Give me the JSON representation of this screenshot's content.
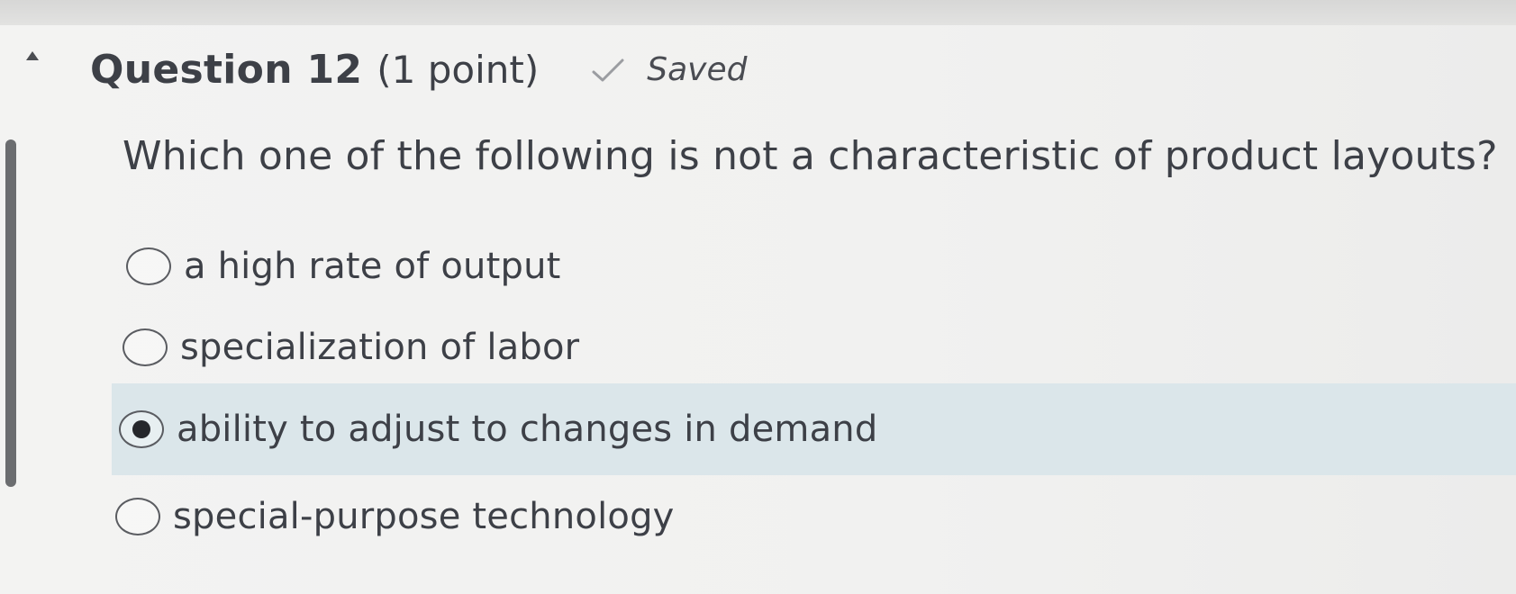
{
  "question": {
    "title": "Question 12",
    "points": "(1 point)",
    "status_label": "Saved",
    "prompt": "Which one of the following is not a characteristic of product layouts?"
  },
  "options": [
    {
      "label": "a high rate of output",
      "selected": false
    },
    {
      "label": "specialization of labor",
      "selected": false
    },
    {
      "label": "ability to adjust to changes in demand",
      "selected": true
    },
    {
      "label": "special-purpose technology",
      "selected": false
    }
  ],
  "colors": {
    "selected_row": "#dbe6ea",
    "text": "#3d4047",
    "rail": "#6b6d70"
  },
  "icons": {
    "collapse": "collapse-up-icon",
    "saved": "check-icon"
  }
}
